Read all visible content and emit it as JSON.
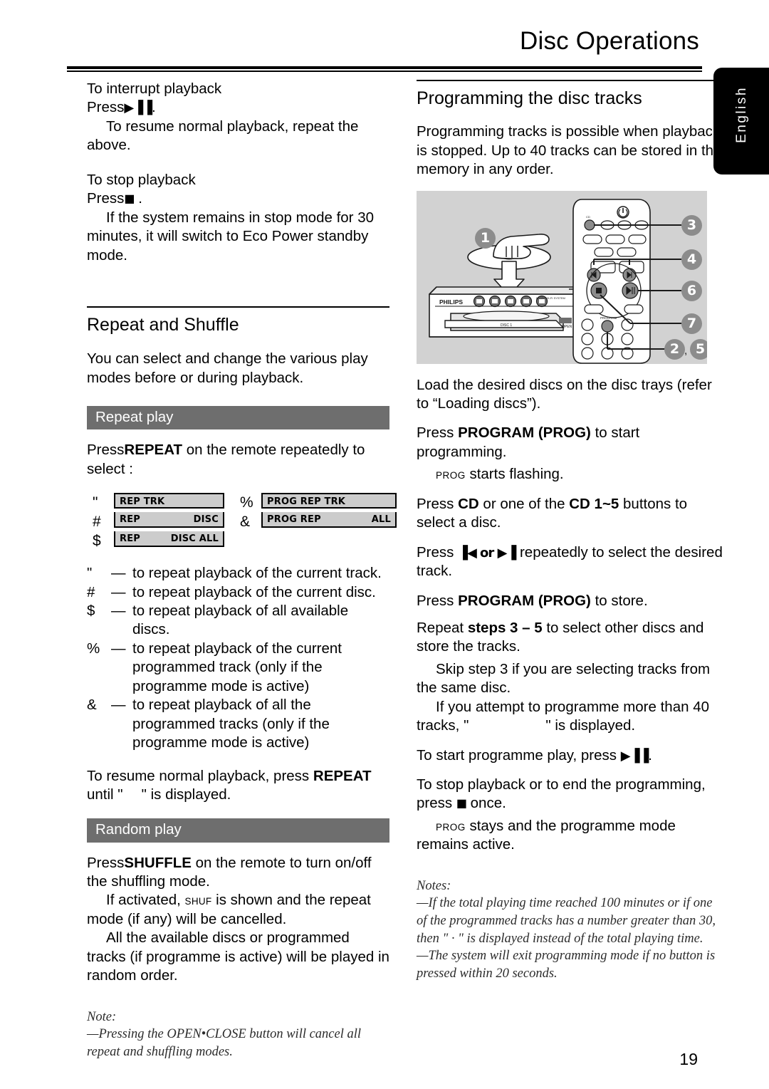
{
  "page": {
    "title": "Disc Operations",
    "number": "19",
    "language_tab": "English"
  },
  "left_column": {
    "interrupt": {
      "heading": "To interrupt playback",
      "press_label": "Press",
      "press_symbol": "▶▐▐",
      "press_period": ".",
      "body": "To resume normal playback, repeat the above."
    },
    "stop": {
      "heading": "To stop playback",
      "press_label": "Press",
      "press_symbol": "■",
      "press_period": ".",
      "body": "If the system remains in stop mode for 30 minutes, it will switch to Eco Power standby mode."
    },
    "repeat_shuffle": {
      "heading": "Repeat and Shuffle",
      "intro": "You can select and change the various play modes before or during playback."
    },
    "repeat_play": {
      "bar_label": "Repeat play",
      "press_prefix": "Press",
      "press_key": "REPEAT",
      "press_suffix": " on the remote repeatedly to select :",
      "displays": [
        {
          "key": "\"",
          "left": "REP TRK",
          "right": ""
        },
        {
          "key": "#",
          "left": "REP",
          "right": "DISC"
        },
        {
          "key": "$",
          "left": "REP",
          "right": "DISC ALL"
        },
        {
          "key": "%",
          "left": "PROG REP TRK",
          "right": ""
        },
        {
          "key": "&",
          "left": "PROG REP",
          "right": "ALL"
        }
      ],
      "explanations": [
        {
          "key": "\"",
          "dash": "—",
          "text": "to repeat playback of the current track."
        },
        {
          "key": "#",
          "dash": "—",
          "text": "to repeat playback of the current disc."
        },
        {
          "key": "$",
          "dash": "—",
          "text": "to repeat playback of all available discs."
        },
        {
          "key": "%",
          "dash": "—",
          "text": "to repeat playback of the current programmed track (only if the programme mode is active)"
        },
        {
          "key": "&",
          "dash": "—",
          "text": "to repeat playback of all the programmed tracks (only if the programme mode is active)"
        }
      ],
      "resume_prefix": "To resume normal playback, press ",
      "resume_key": "REPEAT",
      "resume_suffix_a": "until \"",
      "resume_suffix_b": "\" is displayed."
    },
    "random_play": {
      "bar_label": "Random play",
      "press_prefix": "Press",
      "press_key": "SHUFFLE",
      "press_suffix": " on the remote to turn on/off the shuffling mode.",
      "activated_prefix": "If activated, ",
      "activated_key": "SHUF",
      "activated_suffix": " is shown and the repeat mode (if any) will be cancelled.",
      "random_order": "All the available discs or programmed tracks (if programme is active) will be played in random order."
    },
    "note": {
      "label": "Note:",
      "items": [
        "—Pressing the OPEN•CLOSE button will cancel all repeat and shuffling modes."
      ]
    }
  },
  "right_column": {
    "programming": {
      "heading": "Programming the disc tracks",
      "intro": "Programming tracks is possible when playback is stopped. Up to 40 tracks can be stored in the memory in any order."
    },
    "figure": {
      "brand": "PHILIPS",
      "program_button_label": "PROGRAM",
      "callouts": [
        "1",
        "2",
        "3",
        "4",
        "5",
        "6",
        "7"
      ],
      "callout_pair_label": "2 , 5"
    },
    "steps": [
      {
        "text_a": "Load the desired discs on the disc trays (refer to “Loading discs”).",
        "sub": ""
      },
      {
        "text_a": "Press ",
        "key": "PROGRAM (PROG)",
        "text_b": " to start programming.",
        "sub_key": "PROG",
        "sub": " starts flashing."
      },
      {
        "text_a": "Press ",
        "key": "CD",
        "text_b": " or one of the ",
        "key2": "CD 1~5",
        "text_c": " buttons to select a disc."
      },
      {
        "text_a": "Press ",
        "key": "▐◀  or  ▶▐",
        "text_b": " repeatedly to select the desired track."
      },
      {
        "text_a": "Press ",
        "key": "PROGRAM (PROG)",
        "text_b": " to store."
      },
      {
        "text_a": "Repeat ",
        "key": "steps 3 – 5",
        "text_b": " to select other discs and store the tracks.",
        "sub": "Skip step 3 if you are selecting tracks from the same disc.",
        "sub2_a": "If you attempt to programme more than 40 tracks, \"",
        "sub2_b": "\" is displayed."
      },
      {
        "text_a": "To start programme play, press ",
        "key": "▶▐▐",
        "text_b": "."
      },
      {
        "text_a": "To stop playback or to end the programming, press ",
        "key": "■",
        "text_b": " once.",
        "sub_key": "PROG",
        "sub": " stays and the programme mode remains active."
      }
    ],
    "notes": {
      "label": "Notes:",
      "items": [
        "—If the total playing time reached 100 minutes or if one of the programmed tracks has a number greater than 30, then \"    ·    \" is displayed instead of the total playing time.",
        "—The system will exit programming mode if no button is pressed within 20 seconds."
      ]
    }
  },
  "colors": {
    "bar_gray": "#6e6e6e",
    "display_gray": "#cccccc",
    "figure_bg": "#d2d2d2",
    "tab_black": "#000000"
  }
}
